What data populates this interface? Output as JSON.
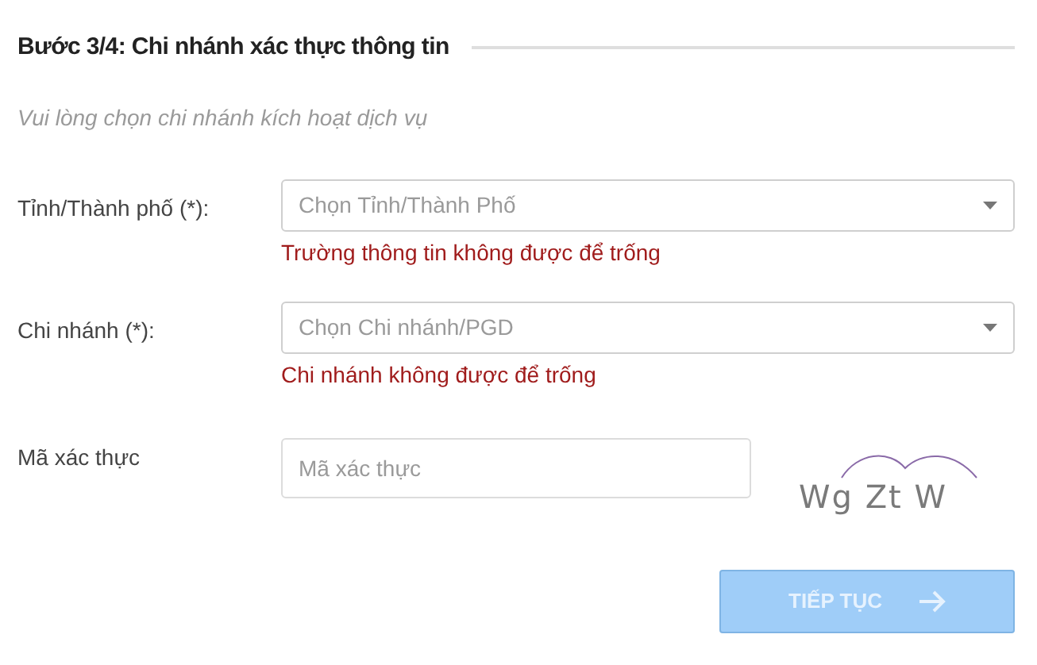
{
  "heading": "Bước 3/4: Chi nhánh xác thực thông tin",
  "subtitle": "Vui lòng chọn chi nhánh kích hoạt dịch vụ",
  "fields": [
    {
      "kind": "select",
      "label": "Tỉnh/Thành phố (*):",
      "placeholder": "Chọn Tỉnh/Thành Phố",
      "error": "Trường thông tin không được để trống"
    },
    {
      "kind": "select",
      "label": "Chi nhánh (*):",
      "placeholder": "Chọn Chi nhánh/PGD",
      "error": "Chi nhánh không được để trống"
    },
    {
      "kind": "captcha",
      "label": "Mã xác thực",
      "placeholder": "Mã xác thực",
      "captcha": "Wg Zt W"
    }
  ],
  "button": {
    "label": "TIẾP TỤC",
    "disabled": true
  }
}
